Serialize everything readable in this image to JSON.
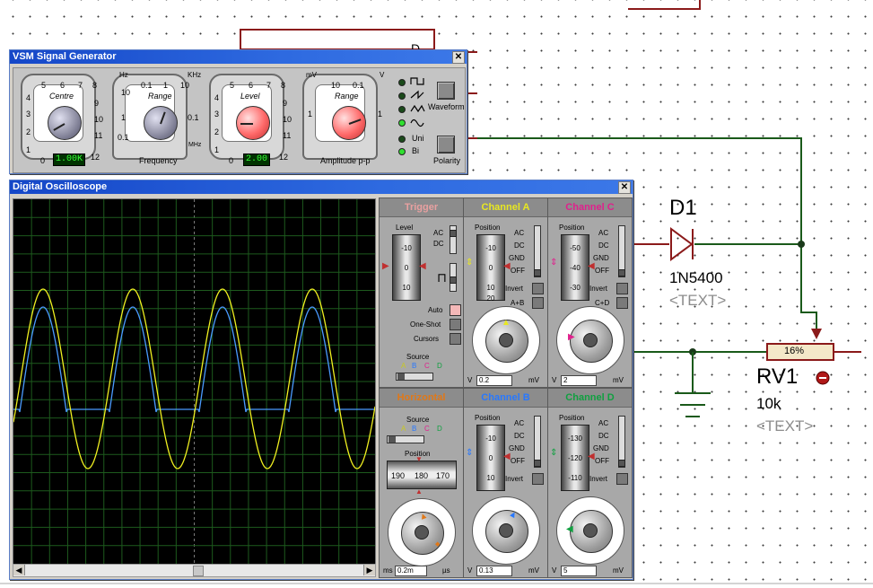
{
  "schematic": {
    "ic_pin_label": "D",
    "diode": {
      "ref": "D1",
      "value": "1N5400",
      "text": "<TEXT>"
    },
    "pot": {
      "percent": "16%",
      "ref": "RV1",
      "value": "10k",
      "text": "<TEXT>"
    }
  },
  "siggen": {
    "title": "VSM Signal Generator",
    "centre": {
      "label": "Centre",
      "ticks": [
        "5",
        "6",
        "7",
        "8",
        "4",
        "9",
        "3",
        "10",
        "2",
        "11",
        "1",
        "0",
        "12"
      ],
      "value": "1.00K"
    },
    "frequency": {
      "range_label": "Range",
      "unit_left": "Hz",
      "unit_right": "KHz",
      "unit_mhz": "MHz",
      "ticks": [
        "0.1",
        "1",
        "10",
        "10",
        "1",
        "0.1",
        "0.1"
      ],
      "caption": "Frequency"
    },
    "level": {
      "label": "Level",
      "ticks": [
        "5",
        "6",
        "7",
        "8",
        "4",
        "9",
        "3",
        "10",
        "2",
        "11",
        "1",
        "0",
        "12"
      ],
      "value": "2.00"
    },
    "amplitude": {
      "range_label": "Range",
      "unit_left": "mV",
      "unit_right": "V",
      "ticks": [
        "10",
        "0.1",
        "1",
        "1"
      ],
      "caption": "Amplitude p-p"
    },
    "waveform": {
      "button_label": "Waveform",
      "selected": "sine"
    },
    "polarity": {
      "uni": "Uni",
      "bi": "Bi",
      "button_label": "Polarity",
      "selected": "Bi"
    }
  },
  "scope": {
    "title": "Digital Oscilloscope",
    "trigger": {
      "title": "Trigger",
      "level": "Level",
      "ticks": [
        "-10",
        "0",
        "10"
      ],
      "ac": "AC",
      "dc": "DC",
      "auto": "Auto",
      "oneshot": "One-Shot",
      "cursors": "Cursors",
      "source": "Source",
      "sources": [
        "A",
        "B",
        "C",
        "D"
      ]
    },
    "horizontal": {
      "title": "Horizontal",
      "source": "Source",
      "sources": [
        "A",
        "B",
        "C",
        "D"
      ],
      "position": "Position",
      "ticks": [
        "190",
        "180",
        "170"
      ],
      "dial_value": "0.2m",
      "unit_left": "ms",
      "unit_right": "µs",
      "dial_ticks": [
        "0.5",
        "0.2",
        "1",
        "2",
        "5",
        "10",
        "20",
        "50",
        "100",
        "200",
        "0.1",
        "0.05",
        "0.02",
        "0.01",
        "0.5",
        "0.2",
        "1",
        "2",
        "5"
      ]
    },
    "channel_a": {
      "title": "Channel A",
      "position": "Position",
      "ticks": [
        "-10",
        "0",
        "10",
        "20"
      ],
      "modes": [
        "AC",
        "DC",
        "GND",
        "OFF"
      ],
      "invert": "Invert",
      "extra": "A+B",
      "value": "0.2",
      "unit_left": "V",
      "unit_right": "mV"
    },
    "channel_b": {
      "title": "Channel B",
      "position": "Position",
      "ticks": [
        "-10",
        "0",
        "10"
      ],
      "modes": [
        "AC",
        "DC",
        "GND",
        "OFF"
      ],
      "invert": "Invert",
      "value": "0.13",
      "unit_left": "V",
      "unit_right": "mV"
    },
    "channel_c": {
      "title": "Channel C",
      "position": "Position",
      "ticks": [
        "-50",
        "-40",
        "-30"
      ],
      "modes": [
        "AC",
        "DC",
        "GND",
        "OFF"
      ],
      "invert": "Invert",
      "extra": "C+D",
      "value": "2",
      "unit_left": "V",
      "unit_right": "mV"
    },
    "channel_d": {
      "title": "Channel D",
      "position": "Position",
      "ticks": [
        "-130",
        "-120",
        "-110"
      ],
      "modes": [
        "AC",
        "DC",
        "GND",
        "OFF"
      ],
      "invert": "Invert",
      "value": "5",
      "unit_left": "V",
      "unit_right": "mV"
    },
    "dial_ticks": [
      "0.5",
      "0.2",
      "1",
      "2",
      "5",
      "10",
      "20",
      "50",
      "100",
      "200",
      "0.1",
      "0.05",
      "0.02",
      "0.01",
      "0.5",
      "0.2",
      "1",
      "2",
      "5"
    ],
    "colors": {
      "trigger_title": "#e8a0a0",
      "horizontal_title": "#e07818",
      "channel_a": "#e8e820",
      "channel_b": "#2878ff",
      "channel_c": "#e0208c",
      "channel_d": "#10a040",
      "trace_a": "#f0f020",
      "trace_b": "#4a9aff",
      "grid": "#1d5a1d"
    }
  }
}
